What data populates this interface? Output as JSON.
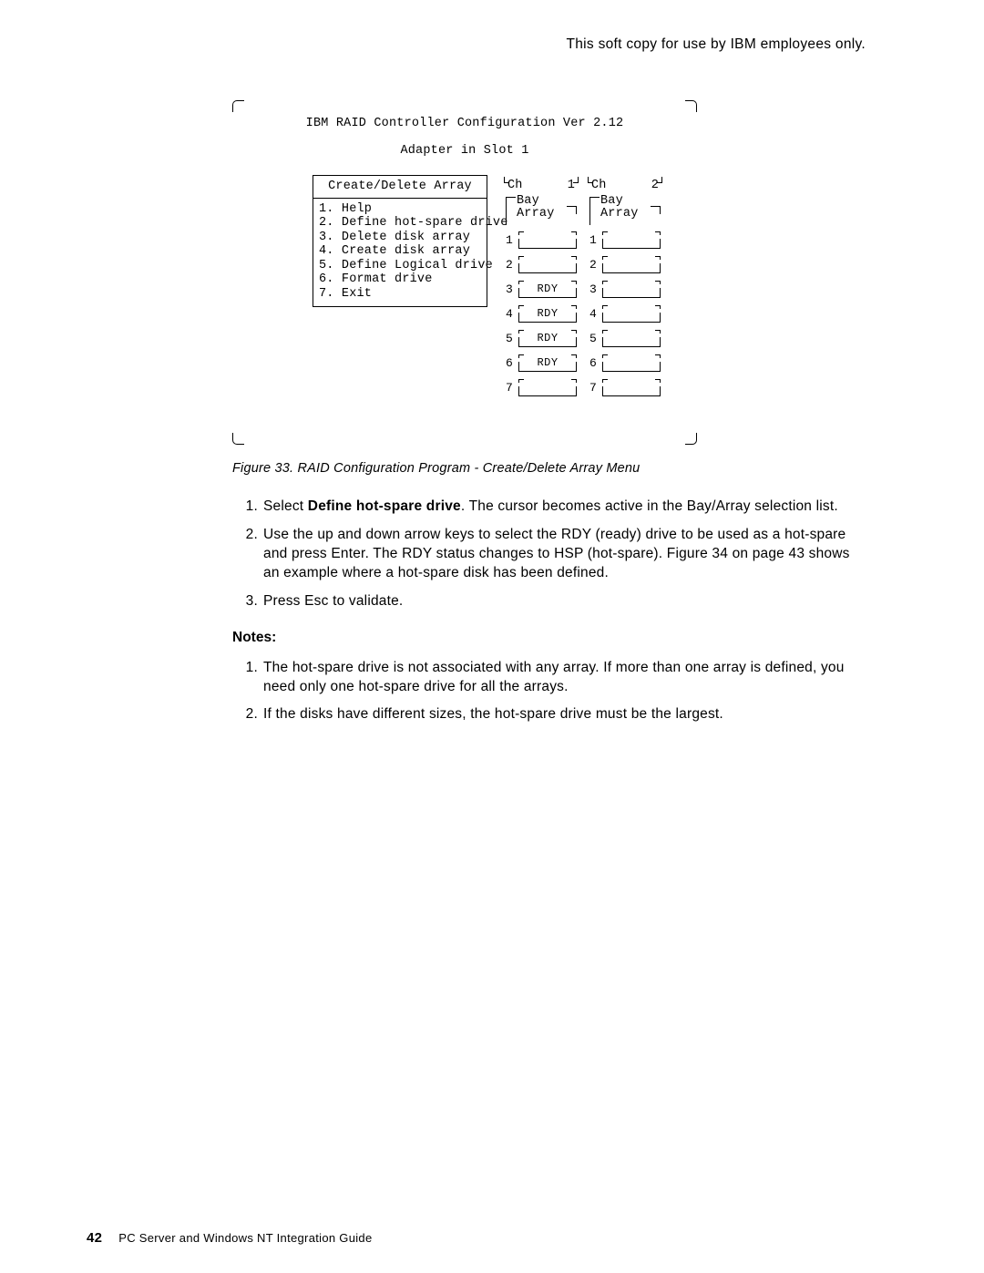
{
  "header_note": "This soft copy for use by IBM employees only.",
  "screen": {
    "title": "IBM RAID Controller Configuration Ver 2.12",
    "subtitle": "Adapter in Slot 1",
    "menu_title": "Create/Delete Array",
    "menu_items": [
      "1. Help",
      "2. Define hot-spare drive",
      "3. Delete disk array",
      "4. Create disk array",
      "5. Define Logical drive",
      "6. Format drive",
      "7. Exit"
    ],
    "channels": [
      {
        "ch_label": "Ch",
        "ch_num": "1",
        "bay": "Bay",
        "array": "Array",
        "slots": [
          {
            "n": "1",
            "status": ""
          },
          {
            "n": "2",
            "status": ""
          },
          {
            "n": "3",
            "status": "RDY"
          },
          {
            "n": "4",
            "status": "RDY"
          },
          {
            "n": "5",
            "status": "RDY"
          },
          {
            "n": "6",
            "status": "RDY"
          },
          {
            "n": "7",
            "status": ""
          }
        ]
      },
      {
        "ch_label": "Ch",
        "ch_num": "2",
        "bay": "Bay",
        "array": "Array",
        "slots": [
          {
            "n": "1",
            "status": ""
          },
          {
            "n": "2",
            "status": ""
          },
          {
            "n": "3",
            "status": ""
          },
          {
            "n": "4",
            "status": ""
          },
          {
            "n": "5",
            "status": ""
          },
          {
            "n": "6",
            "status": ""
          },
          {
            "n": "7",
            "status": ""
          }
        ]
      }
    ]
  },
  "caption_prefix": "Figure 33. ",
  "caption_text": "RAID Configuration Program - Create/Delete Array Menu",
  "steps": [
    {
      "n": "1.",
      "pre": "Select ",
      "bold": "Define hot-spare drive",
      "post": ".  The cursor becomes active in the Bay/Array selection list."
    },
    {
      "n": "2.",
      "pre": "",
      "bold": "",
      "post": "Use the up and down arrow keys to select the RDY (ready) drive to be used as a hot-spare and press Enter. The RDY status changes to HSP (hot-spare). Figure 34 on page 43 shows an example where a hot-spare disk has been defined."
    },
    {
      "n": "3.",
      "pre": "",
      "bold": "",
      "post": "Press Esc to validate."
    }
  ],
  "notes_heading": "Notes:",
  "notes": [
    {
      "n": "1.",
      "t": "The hot-spare drive is not associated with any array.  If more than one array is defined, you need only one hot-spare drive for all the arrays."
    },
    {
      "n": "2.",
      "t": "If the disks have different sizes, the hot-spare drive must be the largest."
    }
  ],
  "footer": {
    "page": "42",
    "title": "PC Server and Windows NT Integration Guide"
  }
}
